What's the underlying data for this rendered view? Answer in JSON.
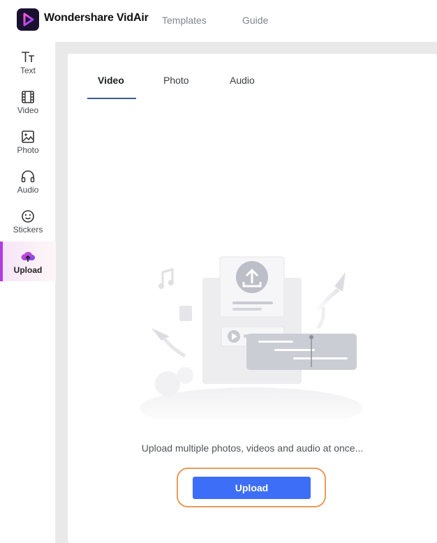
{
  "app": {
    "brand": "Wondershare VidAir",
    "nav": {
      "templates": "Templates",
      "guide": "Guide"
    }
  },
  "sidebar": {
    "items": [
      {
        "label": "Text",
        "icon": "text-icon"
      },
      {
        "label": "Video",
        "icon": "film-icon"
      },
      {
        "label": "Photo",
        "icon": "image-icon"
      },
      {
        "label": "Audio",
        "icon": "headphones-icon"
      },
      {
        "label": "Stickers",
        "icon": "smiley-icon"
      },
      {
        "label": "Upload",
        "icon": "cloud-upload-icon",
        "active": true
      }
    ]
  },
  "panel": {
    "tabs": [
      {
        "label": "Video",
        "active": true
      },
      {
        "label": "Photo"
      },
      {
        "label": "Audio"
      }
    ],
    "hint": "Upload multiple photos, videos and audio at once...",
    "upload_label": "Upload"
  },
  "colors": {
    "accent": "#3d6ef7",
    "active_bar": "#b13ce0",
    "highlight_ring": "#e79b5a",
    "tab_underline": "#3d5b8c"
  }
}
